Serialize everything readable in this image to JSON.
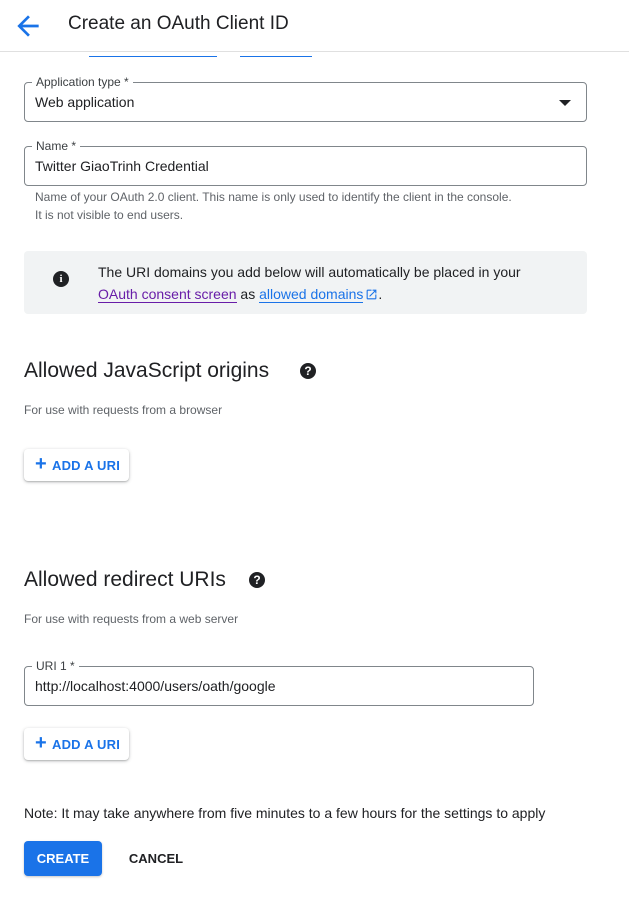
{
  "header": {
    "title": "Create an OAuth Client ID",
    "back_icon": "arrow-back-icon"
  },
  "application_type": {
    "label": "Application type *",
    "value": "Web application"
  },
  "name_field": {
    "label": "Name *",
    "value": "Twitter GiaoTrinh Credential",
    "hint_line1": "Name of your OAuth 2.0 client. This name is only used to identify the client in the console.",
    "hint_line2": "It is not visible to end users."
  },
  "info": {
    "text_before": "The URI domains you add below will automatically be placed in your",
    "link1": "OAuth consent screen",
    "text_mid": " as ",
    "link2": "allowed domains",
    "text_end": "."
  },
  "js_origins": {
    "title": "Allowed JavaScript origins",
    "description": "For use with requests from a browser",
    "add_label": "ADD A URI"
  },
  "redirect_uris": {
    "title": "Allowed redirect URIs",
    "description": "For use with requests from a web server",
    "uri_label": "URI 1 *",
    "uri_value": "http://localhost:4000/users/oath/google",
    "add_label": "ADD A URI"
  },
  "note": "Note: It may take anywhere from five minutes to a few hours for the settings to apply",
  "actions": {
    "create": "CREATE",
    "cancel": "CANCEL"
  },
  "colors": {
    "primary": "#1a73e8",
    "visited_link": "#681da8",
    "info_bg": "#f1f3f4"
  }
}
